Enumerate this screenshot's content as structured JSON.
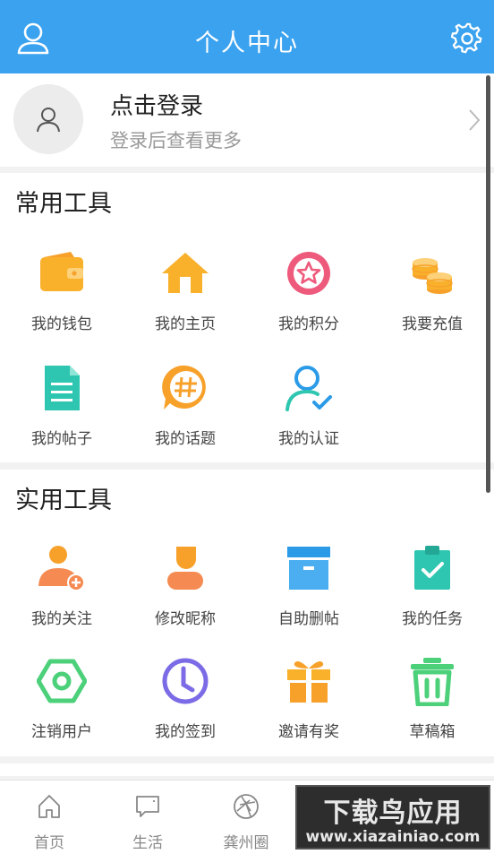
{
  "header": {
    "title": "个人中心",
    "user_icon": "user-icon",
    "settings_icon": "gear-icon"
  },
  "profile": {
    "title": "点击登录",
    "subtitle": "登录后查看更多",
    "avatar_icon": "person-icon"
  },
  "common_tools": {
    "title": "常用工具",
    "items": [
      {
        "label": "我的钱包",
        "icon": "wallet-icon"
      },
      {
        "label": "我的主页",
        "icon": "home-icon"
      },
      {
        "label": "我的积分",
        "icon": "star-badge-icon"
      },
      {
        "label": "我要充值",
        "icon": "coins-icon"
      },
      {
        "label": "我的帖子",
        "icon": "document-icon"
      },
      {
        "label": "我的话题",
        "icon": "hashtag-bubble-icon"
      },
      {
        "label": "我的认证",
        "icon": "verified-user-icon"
      }
    ]
  },
  "practical_tools": {
    "title": "实用工具",
    "items": [
      {
        "label": "我的关注",
        "icon": "add-user-icon"
      },
      {
        "label": "修改昵称",
        "icon": "edit-user-icon"
      },
      {
        "label": "自助删帖",
        "icon": "archive-box-icon"
      },
      {
        "label": "我的任务",
        "icon": "clipboard-check-icon"
      },
      {
        "label": "注销用户",
        "icon": "hexagon-ring-icon"
      },
      {
        "label": "我的签到",
        "icon": "clock-icon"
      },
      {
        "label": "邀请有奖",
        "icon": "gift-icon"
      },
      {
        "label": "草稿箱",
        "icon": "trash-icon"
      }
    ]
  },
  "tabbar": {
    "items": [
      {
        "label": "首页",
        "icon": "home-outline-icon"
      },
      {
        "label": "生活",
        "icon": "chat-outline-icon"
      },
      {
        "label": "龚州圈",
        "icon": "aperture-icon"
      }
    ]
  },
  "watermark": {
    "top": "下载鸟应用",
    "bottom": "www.xiazainiao.com"
  },
  "colors": {
    "header": "#3aa2ef",
    "orange": "#f7a12b",
    "pink": "#ee5a7c",
    "teal": "#2ec6b0",
    "blue": "#2b9be8"
  }
}
